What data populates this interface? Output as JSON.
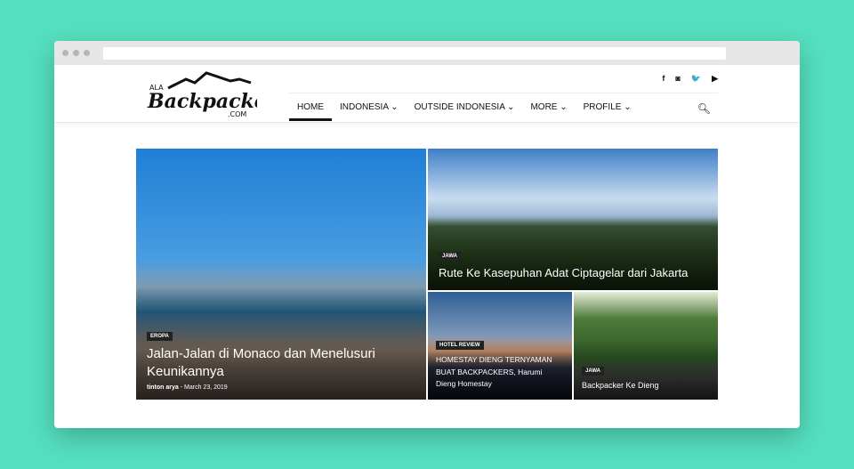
{
  "site": {
    "logo_text": "ALA Backpacker .COM"
  },
  "social": [
    {
      "icon": "facebook-icon",
      "glyph": "f"
    },
    {
      "icon": "instagram-icon",
      "glyph": "◙"
    },
    {
      "icon": "twitter-icon",
      "glyph": "🐦"
    },
    {
      "icon": "youtube-icon",
      "glyph": "▶"
    }
  ],
  "nav": [
    {
      "label": "HOME"
    },
    {
      "label": "INDONESIA ⌄"
    },
    {
      "label": "OUTSIDE INDONESIA ⌄"
    },
    {
      "label": "MORE ⌄"
    },
    {
      "label": "PROFILE ⌄"
    }
  ],
  "posts": [
    {
      "category": "EROPA",
      "title": "Jalan-Jalan di Monaco dan Menelusuri Keunikannya",
      "author": "tinton arya",
      "date": "March 23, 2019"
    },
    {
      "category": "JAWA",
      "title": "Rute Ke Kasepuhan Adat Ciptagelar dari Jakarta"
    },
    {
      "category": "HOTEL REVIEW",
      "title": "HOMESTAY DIENG TERNYAMAN BUAT BACKPACKERS, Harumi Dieng Homestay"
    },
    {
      "category": "JAWA",
      "title": "Backpacker Ke Dieng"
    }
  ]
}
